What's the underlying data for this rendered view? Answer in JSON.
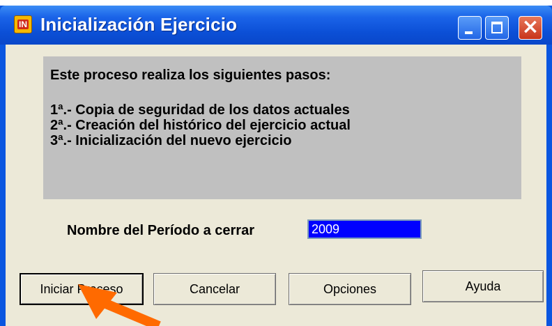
{
  "window": {
    "title": "Inicialización Ejercicio",
    "icon_text": "IN"
  },
  "info": {
    "heading": "Este proceso realiza los siguientes pasos:",
    "steps": [
      "1ª.- Copia de seguridad de los datos actuales",
      "2ª.- Creación del histórico del ejercicio actual",
      "3ª.- Inicialización del nuevo ejercicio"
    ]
  },
  "period": {
    "label": "Nombre del Período a cerrar",
    "value": "2009"
  },
  "buttons": {
    "start": "Iniciar Proceso",
    "cancel": "Cancelar",
    "options": "Opciones",
    "help": "Ayuda"
  },
  "colors": {
    "titlebar": "#0a56e0",
    "panel": "#c0c0c0",
    "input_bg": "#0000ff",
    "annotation_arrow": "#ff6a00"
  },
  "icons": {
    "app": "app-icon",
    "minimize": "minimize-icon",
    "maximize": "maximize-icon",
    "close": "close-icon",
    "annotation": "pointer-arrow"
  }
}
